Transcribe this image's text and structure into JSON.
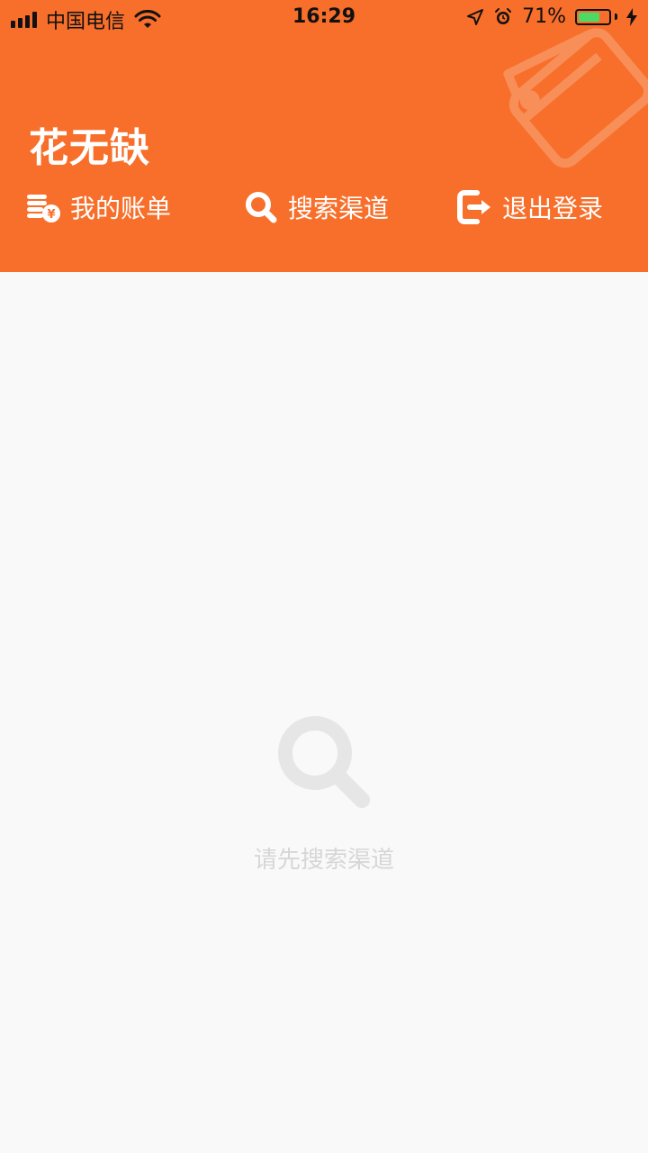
{
  "status_bar": {
    "carrier": "中国电信",
    "time": "16:29",
    "battery_percent": "71%",
    "battery_level": 0.71
  },
  "header": {
    "title": "花无缺",
    "background_color": "#f76f2a"
  },
  "actions": [
    {
      "label": "我的账单",
      "icon": "bill-coin-icon"
    },
    {
      "label": "搜索渠道",
      "icon": "search-icon"
    },
    {
      "label": "退出登录",
      "icon": "logout-icon"
    }
  ],
  "empty_state": {
    "icon": "search-icon",
    "message": "请先搜索渠道"
  }
}
